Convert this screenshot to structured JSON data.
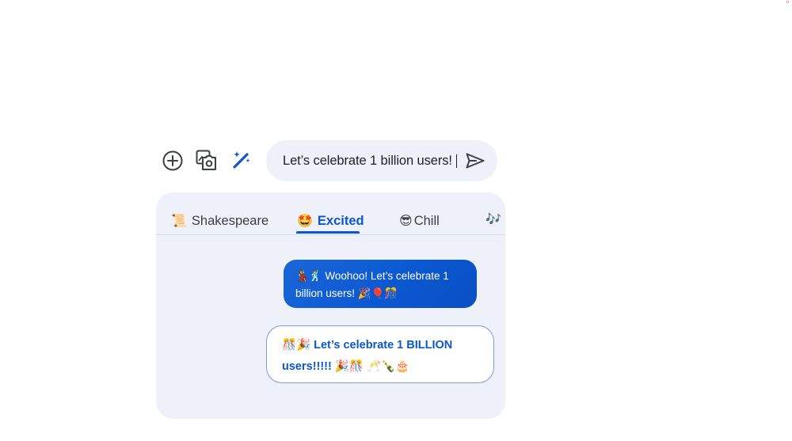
{
  "corner_mark": "\"",
  "toolbar": {
    "add_icon": "add-circle-icon",
    "gallery_icon": "photo-gallery-icon",
    "magic_icon": "magic-wand-icon"
  },
  "compose": {
    "text": "Let’s celebrate 1 billion users!",
    "send_icon": "send-icon"
  },
  "tabs": [
    {
      "emoji": "📜",
      "label": "Shakespeare"
    },
    {
      "emoji": "🤩",
      "label": "Excited",
      "selected": true
    },
    {
      "emoji": "😎",
      "label": "Chill"
    },
    {
      "emoji": "🎶",
      "label": ""
    }
  ],
  "suggestions": [
    {
      "text": "💃🕺 Woohoo! Let’s celebrate 1 billion users! 🎉🎈🎊"
    },
    {
      "text": "🎊🎉 Let’s celebrate 1 BILLION users!!!!! 🎉🎊 🥂🍾🎂"
    }
  ],
  "colors": {
    "accent": "#0b57d0",
    "panel_bg": "#eef1fa",
    "music_tab": "#9334e6"
  }
}
